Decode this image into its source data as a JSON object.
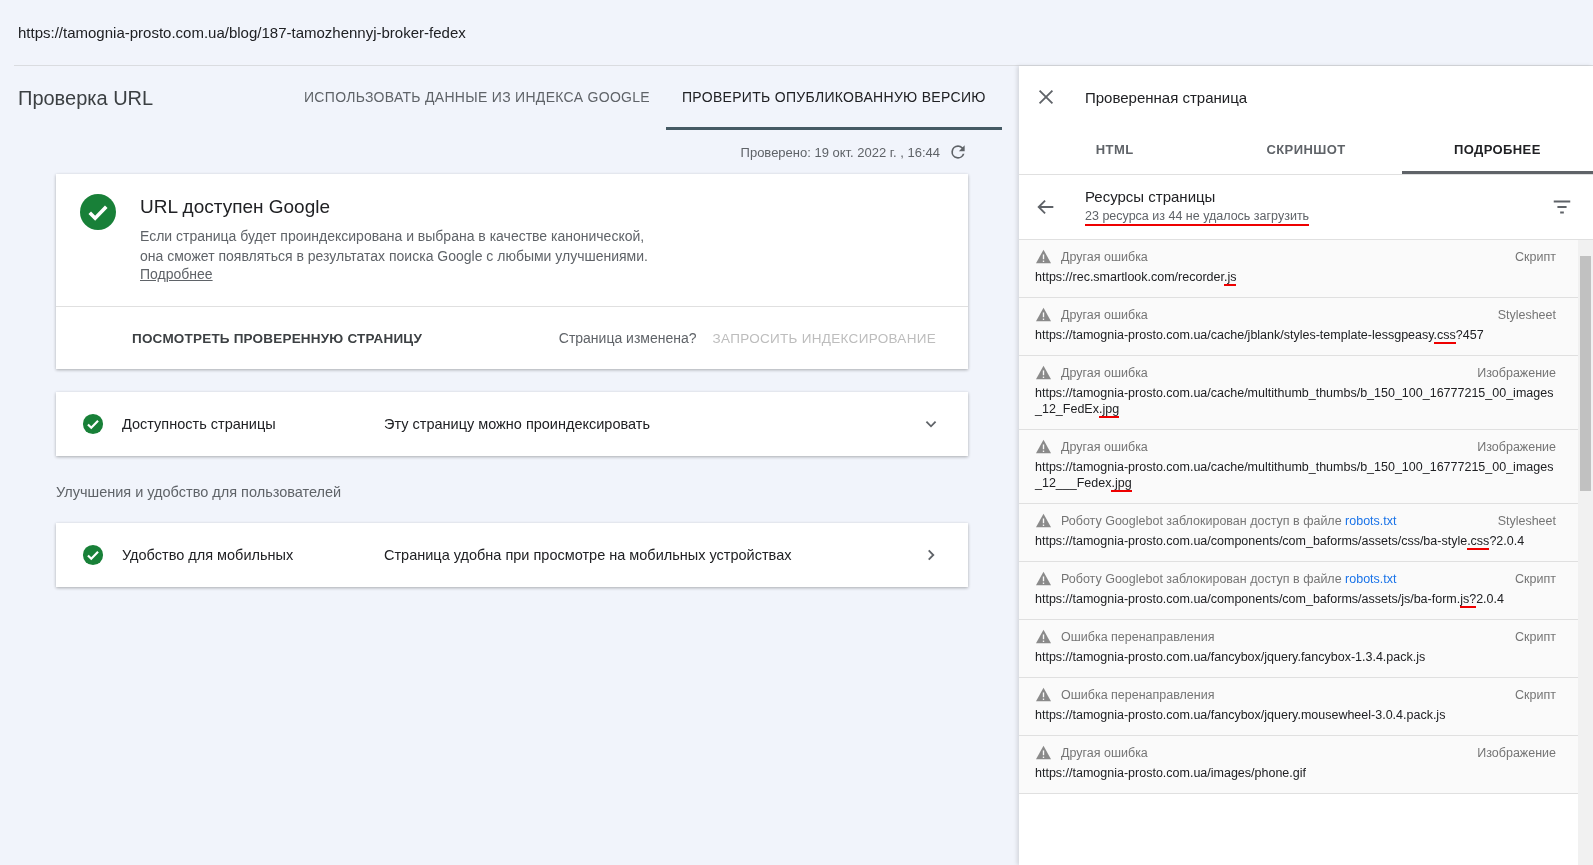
{
  "address_bar": {
    "url": "https://tamognia-prosto.com.ua/blog/187-tamozhennyj-broker-fedex"
  },
  "inspection": {
    "title": "Проверка URL",
    "tabs": [
      {
        "label": "ИСПОЛЬЗОВАТЬ ДАННЫЕ ИЗ ИНДЕКСА GOOGLE",
        "selected": false
      },
      {
        "label": "ПРОВЕРИТЬ ОПУБЛИКОВАННУЮ ВЕРСИЮ",
        "selected": true
      }
    ],
    "checked_time": "Проверено: 19 окт. 2022 г. , 16:44",
    "status_card": {
      "title": "URL доступен Google",
      "description_lines": [
        "Если страница будет проиндексирована и выбрана в качестве канонической,",
        "она сможет появляться в результатах поиска Google с любыми улучшениями."
      ],
      "link": "Подробнее",
      "view_button": "ПОСМОТРЕТЬ ПРОВЕРЕННУЮ СТРАНИЦУ",
      "changed_prompt": "Страница изменена?",
      "request_button": {
        "label": "ЗАПРОСИТЬ ИНДЕКСИРОВАНИЕ",
        "disabled": true
      }
    },
    "checks": [
      {
        "kind": "expand",
        "label": "Доступность страницы",
        "result": "Эту страницу можно проиндексировать"
      }
    ],
    "enhancements_heading": "Улучшения и удобство для пользователей",
    "enhancements": [
      {
        "kind": "open",
        "label": "Удобство для мобильных",
        "result": "Страница удобна при просмотре на мобильных устройствах"
      }
    ]
  },
  "panel": {
    "title": "Проверенная страница",
    "tabs": [
      {
        "label": "HTML",
        "selected": false
      },
      {
        "label": "СКРИНШОТ",
        "selected": false
      },
      {
        "label": "ПОДРОБНЕЕ",
        "selected": true
      }
    ],
    "section": {
      "title": "Ресурсы страницы",
      "summary": {
        "text": "23 ресурса из 44 не удалось загрузить",
        "underlined": true
      }
    },
    "resources": [
      {
        "error": "Другая ошибка",
        "type": "Скрипт",
        "url_parts": [
          {
            "text": "https://rec.smartlook.com/recorder",
            "underlined": false
          },
          {
            "text": ".js",
            "underlined": true
          }
        ]
      },
      {
        "error": "Другая ошибка",
        "type": "Stylesheet",
        "url_parts": [
          {
            "text": "https://tamognia-prosto.com.ua/cache/jblank/styles-template-lessgpeasy",
            "underlined": false
          },
          {
            "text": ".css",
            "underlined": true
          },
          {
            "text": "?457",
            "underlined": false
          }
        ]
      },
      {
        "error": "Другая ошибка",
        "type": "Изображение",
        "url_parts": [
          {
            "text": "https://tamognia-prosto.com.ua/cache/multithumb_thumbs/b_150_100_16777215_00_images_12_FedEx",
            "underlined": false
          },
          {
            "text": ".jpg",
            "underlined": true
          }
        ]
      },
      {
        "error": "Другая ошибка",
        "type": "Изображение",
        "url_parts": [
          {
            "text": "https://tamognia-prosto.com.ua/cache/multithumb_thumbs/b_150_100_16777215_00_images_12___Fedex",
            "underlined": false
          },
          {
            "text": ".jpg",
            "underlined": true
          }
        ]
      },
      {
        "error": "Роботу Googlebot заблокирован доступ в файле",
        "error_link": "robots.txt",
        "type": "Stylesheet",
        "url_parts": [
          {
            "text": "https://tamognia-prosto.com.ua/components/com_baforms/assets/css/ba-style",
            "underlined": false
          },
          {
            "text": ".css",
            "underlined": true
          },
          {
            "text": "?2.0.4",
            "underlined": false
          }
        ]
      },
      {
        "error": "Роботу Googlebot заблокирован доступ в файле",
        "error_link": "robots.txt",
        "type": "Скрипт",
        "url_parts": [
          {
            "text": "https://tamognia-prosto.com.ua/components/com_baforms/assets/js/ba-form.",
            "underlined": false
          },
          {
            "text": "js?",
            "underlined": true
          },
          {
            "text": "2.0.4",
            "underlined": false
          }
        ]
      },
      {
        "error": "Ошибка перенаправления",
        "type": "Скрипт",
        "url_parts": [
          {
            "text": "https://tamognia-prosto.com.ua/fancybox/jquery.fancybox-1.3.4.pack.js",
            "underlined": false
          }
        ]
      },
      {
        "error": "Ошибка перенаправления",
        "type": "Скрипт",
        "url_parts": [
          {
            "text": "https://tamognia-prosto.com.ua/fancybox/jquery.mousewheel-3.0.4.pack.js",
            "underlined": false
          }
        ]
      },
      {
        "error": "Другая ошибка",
        "type": "Изображение",
        "url_parts": [
          {
            "text": "https://tamognia-prosto.com.ua/images/phone.gif",
            "underlined": false
          }
        ]
      }
    ]
  }
}
